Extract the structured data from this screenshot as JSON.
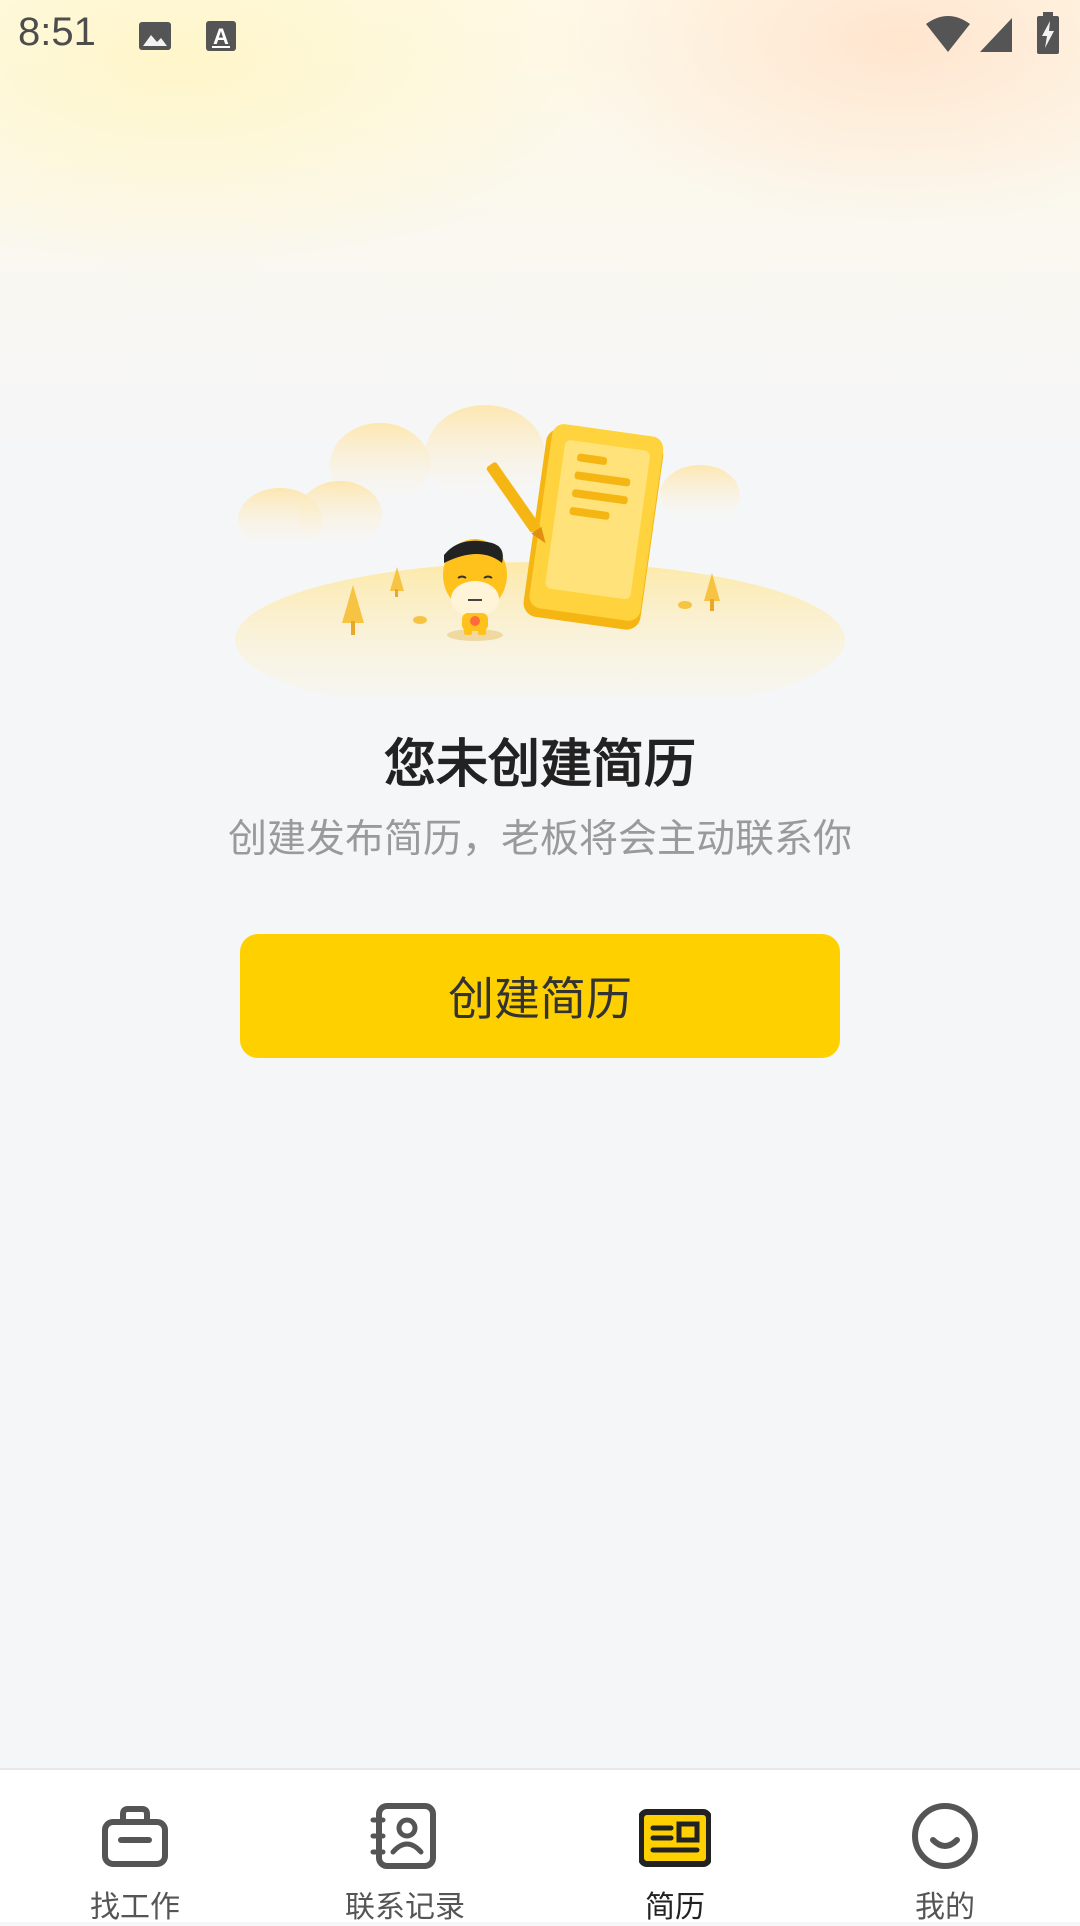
{
  "status_bar": {
    "time": "8:51",
    "icons": [
      "image-icon",
      "a-badge-icon",
      "wifi-icon",
      "signal-icon",
      "battery-charging-icon"
    ]
  },
  "empty_state": {
    "title": "您未创建简历",
    "subtitle": "创建发布简历，老板将会主动联系你",
    "button_label": "创建简历",
    "illustration": "mascot-with-resume-illustration"
  },
  "tabs": [
    {
      "label": "找工作",
      "icon": "briefcase-icon",
      "active": false
    },
    {
      "label": "联系记录",
      "icon": "contact-book-icon",
      "active": false
    },
    {
      "label": "简历",
      "icon": "resume-card-icon",
      "active": true
    },
    {
      "label": "我的",
      "icon": "smile-face-icon",
      "active": false
    }
  ],
  "colors": {
    "accent": "#ffd000",
    "background": "#f5f6f8",
    "text_primary": "#222222",
    "text_secondary": "#9a9a9a"
  }
}
